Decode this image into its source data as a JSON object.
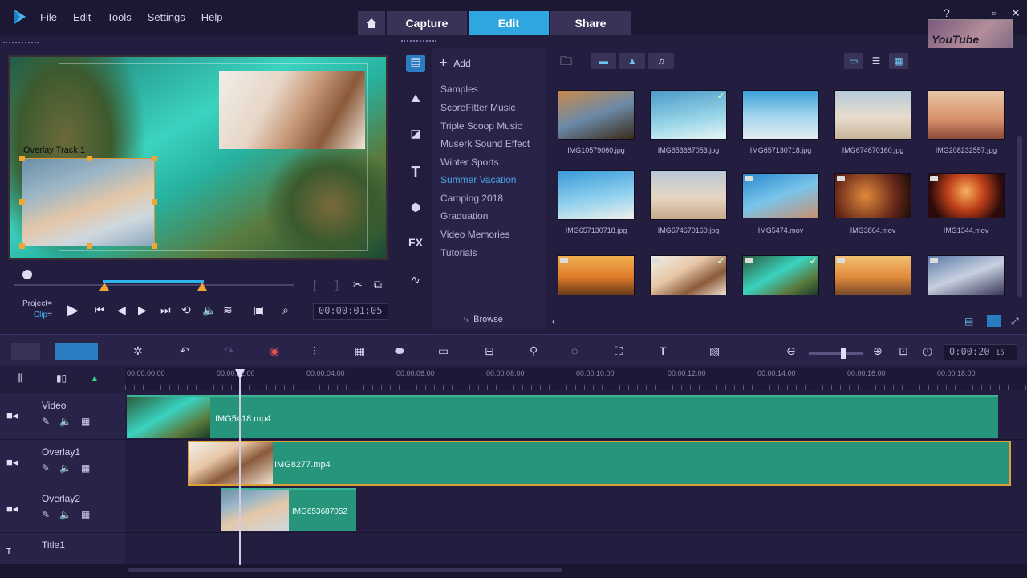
{
  "menu": [
    {
      "label": "File",
      "u": "F"
    },
    {
      "label": "Edit",
      "u": "E"
    },
    {
      "label": "Tools",
      "u": "T"
    },
    {
      "label": "Settings",
      "u": "S"
    },
    {
      "label": "Help",
      "u": "H"
    }
  ],
  "modes": {
    "capture": "Capture",
    "edit": "Edit",
    "share": "Share"
  },
  "preview": {
    "overlay_label": "Overlay Track 1",
    "project_label": "Project",
    "clip_label": "Clip",
    "timecode": "00:00:01:05"
  },
  "library": {
    "add_label": "Add",
    "items": [
      "Samples",
      "ScoreFitter Music",
      "Triple Scoop Music",
      "Muserk Sound Effect",
      "Winter Sports",
      "Summer Vacation",
      "Camping 2018",
      "Graduation",
      "Video Memories",
      "Tutorials"
    ],
    "active_index": 5,
    "browse_label": "Browse",
    "fx_label": "FX"
  },
  "media": {
    "thumbs": [
      {
        "name": "IMG10579060.jpg",
        "checked": false,
        "video": false
      },
      {
        "name": "IMG653687053.jpg",
        "checked": true,
        "video": false
      },
      {
        "name": "IMG657130718.jpg",
        "checked": false,
        "video": false
      },
      {
        "name": "IMG674670160.jpg",
        "checked": false,
        "video": false
      },
      {
        "name": "IMG208232557.jpg",
        "checked": false,
        "video": false
      },
      {
        "name": "IMG657130718.jpg",
        "checked": false,
        "video": false
      },
      {
        "name": "IMG674670160.jpg",
        "checked": false,
        "video": false
      },
      {
        "name": "IMG5474.mov",
        "checked": false,
        "video": true
      },
      {
        "name": "IMG3864.mov",
        "checked": false,
        "video": true
      },
      {
        "name": "IMG1344.mov",
        "checked": false,
        "video": true
      },
      {
        "name": "",
        "checked": false,
        "video": true
      },
      {
        "name": "",
        "checked": true,
        "video": true
      },
      {
        "name": "",
        "checked": true,
        "video": true
      },
      {
        "name": "",
        "checked": false,
        "video": true
      },
      {
        "name": "",
        "checked": false,
        "video": true
      }
    ]
  },
  "timeline": {
    "time": "0:00:20",
    "time_suffix": "15",
    "ruler": [
      "00:00:00:00",
      "00:00:02:00",
      "00:00:04:00",
      "00:00:06:00",
      "00:00:08:00",
      "00:00:10:00",
      "00:00:12:00",
      "00:00:14:00",
      "00:00:16:00",
      "00:00:18:00"
    ],
    "tracks": [
      {
        "name": "Video",
        "clip": "IMG5418.mp4"
      },
      {
        "name": "Overlay1",
        "clip": "IMG8277.mp4"
      },
      {
        "name": "Overlay2",
        "clip": "IMG653687052"
      },
      {
        "name": "Title1",
        "clip": ""
      }
    ],
    "title_tool": "T"
  },
  "watermark": {
    "text": "YouTube JOBS"
  },
  "colors": {
    "accent": "#2fa6e0",
    "clip": "#26957c",
    "selection": "#e0a035",
    "bg": "#221c3d"
  }
}
